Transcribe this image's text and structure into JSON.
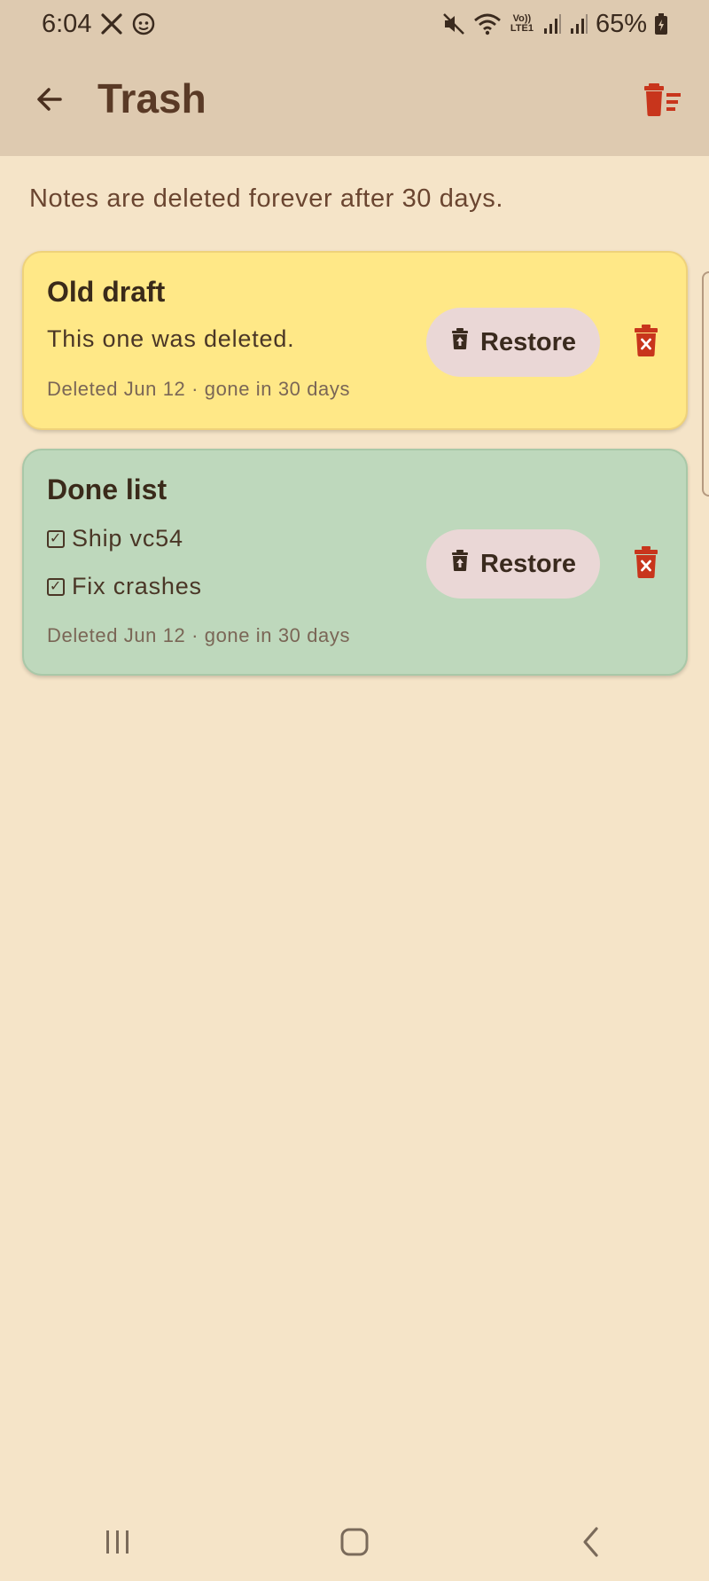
{
  "status_bar": {
    "time": "6:04",
    "battery": "65%",
    "left_icons": [
      "x-app-icon",
      "face-app-icon"
    ],
    "right_icons": [
      "mute-icon",
      "wifi-icon",
      "volte-icon",
      "signal-1-icon",
      "signal-2-icon",
      "battery-icon"
    ],
    "volte_text": "Vo)) LTE1"
  },
  "app_bar": {
    "title": "Trash",
    "back_icon": "arrow-left-icon",
    "empty_trash_icon": "delete-sweep-icon"
  },
  "info_text": "Notes are deleted forever after 30 days.",
  "notes": [
    {
      "title": "Old draft",
      "body": "This one was deleted.",
      "meta": "Deleted Jun 12 · gone in 30 days",
      "color": "#ffe887",
      "restore_label": "Restore"
    },
    {
      "title": "Done list",
      "items": [
        {
          "text": "Ship vc54",
          "checked": true
        },
        {
          "text": "Fix crashes",
          "checked": true
        }
      ],
      "meta": "Deleted Jun 12 · gone in 30 days",
      "color": "#bed8bc",
      "restore_label": "Restore"
    }
  ],
  "colors": {
    "background": "#f5e4c8",
    "app_bar": "#decab0",
    "accent_red": "#c8351c",
    "restore_button": "#ead7d6"
  },
  "nav_bar": {
    "icons": [
      "recent-apps-icon",
      "home-icon",
      "back-icon"
    ]
  }
}
